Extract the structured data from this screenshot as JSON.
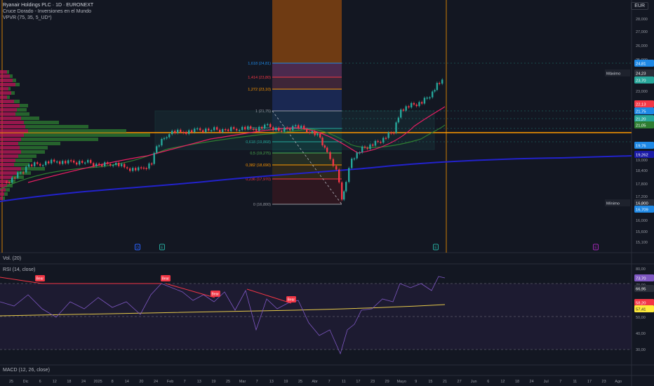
{
  "header": {
    "title": "Ryanair Holdings PLC · 1D · EURONEXT",
    "indicator1": "Cruce Dorado - Inversiones en el Mundo",
    "indicator2": "VPVR (75, 35, 5_UD*)"
  },
  "currency": "EUR",
  "price_axis": {
    "ticks": [
      "28,000",
      "27,000",
      "26,000",
      "25,000",
      "24,000",
      "23,000",
      "22,000",
      "21,000",
      "20,000",
      "19,000",
      "18,400",
      "17,800",
      "17,200",
      "16,600",
      "16,000",
      "15,600",
      "15,100"
    ]
  },
  "price_tags": [
    {
      "label": "",
      "value": "24,81",
      "color": "#1e88e5"
    },
    {
      "label": "Máximo",
      "value": "24,23",
      "color": "#2a2e39"
    },
    {
      "label": "",
      "value": "23,70",
      "color": "#26a69a"
    },
    {
      "label": "",
      "value": "22,13",
      "color": "#f23645"
    },
    {
      "label": "",
      "value": "21,75",
      "color": "#1e88e5"
    },
    {
      "label": "",
      "value": "21,20",
      "color": "#26a69a"
    },
    {
      "label": "",
      "value": "21,05",
      "color": "#2e7d32"
    },
    {
      "label": "",
      "value": "19,76",
      "color": "#1e88e5"
    },
    {
      "label": "",
      "value": "19,262",
      "color": "#1a1aa6"
    },
    {
      "label": "Mínimo",
      "value": "16,800",
      "color": "#2a2e39"
    },
    {
      "label": "",
      "value": "16,709",
      "color": "#1e88e5"
    }
  ],
  "fib_levels": [
    {
      "label": "1,618 (24,81)",
      "color": "#1e88e5"
    },
    {
      "label": "1,414 (23,80)",
      "color": "#f23645"
    },
    {
      "label": "1,272 (23,10)",
      "color": "#ff9800"
    },
    {
      "label": "1 (21,75)",
      "color": "#9598a1"
    },
    {
      "label": "0,786 (20,70)",
      "color": "#26a69a"
    },
    {
      "label": "0,618 (19,868)",
      "color": "#26a69a"
    },
    {
      "label": "0,5 (19,275)",
      "color": "#4caf50"
    },
    {
      "label": "0,382 (18,690)",
      "color": "#ff9800"
    },
    {
      "label": "0,236 (17,970)",
      "color": "#f23645"
    },
    {
      "label": "0 (16,800)",
      "color": "#9598a1"
    }
  ],
  "volume_label": "Vol. (20)",
  "rsi": {
    "label": "RSI (14, close)",
    "ticks": [
      "80,00",
      "70,00",
      "60,00",
      "50,00",
      "40,00",
      "30,00"
    ],
    "tags": [
      {
        "value": "73,70",
        "color": "#7e57c2"
      },
      {
        "value": "66,95",
        "color": "#2a2e39"
      },
      {
        "value": "58,20",
        "color": "#f23645"
      },
      {
        "value": "57,41",
        "color": "#ffeb3b"
      }
    ],
    "divergence_labels": [
      "Bear",
      "Bear",
      "Bear",
      "Bear"
    ]
  },
  "macd_label": "MACD (12, 26, close)",
  "time_axis": [
    "25",
    "Dic",
    "6",
    "12",
    "18",
    "24",
    "2025",
    "8",
    "14",
    "20",
    "24",
    "Feb",
    "7",
    "13",
    "19",
    "25",
    "Mar",
    "7",
    "13",
    "19",
    "25",
    "Abr",
    "7",
    "11",
    "17",
    "23",
    "29",
    "Mayo",
    "9",
    "15",
    "21",
    "27",
    "Jun",
    "6",
    "12",
    "18",
    "24",
    "Jul",
    "7",
    "11",
    "17",
    "23",
    "Ago"
  ],
  "event_markers": [
    "D",
    "E",
    "E",
    "E"
  ]
}
